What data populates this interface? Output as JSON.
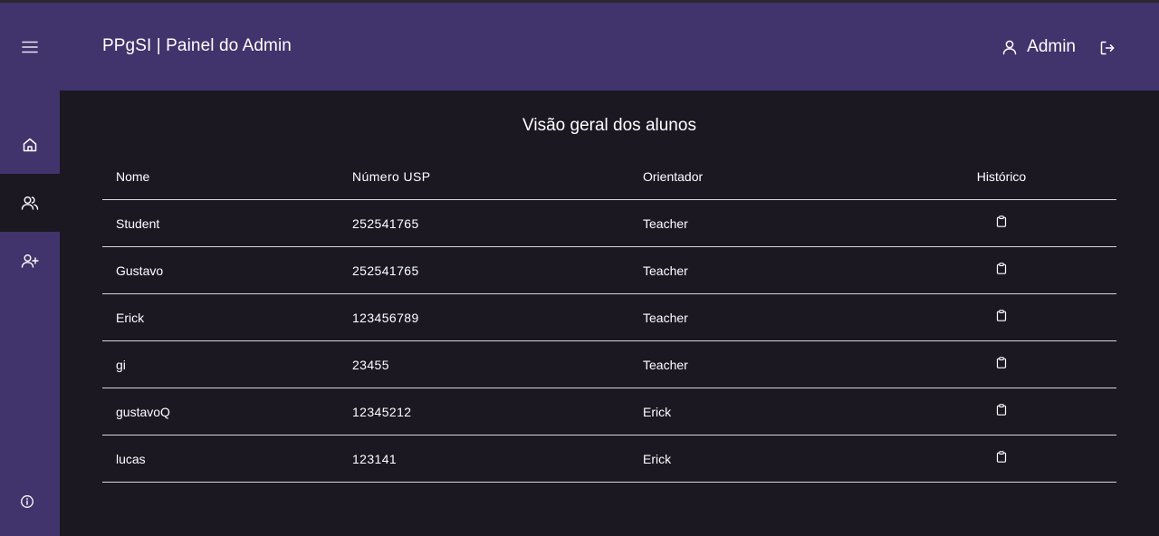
{
  "header": {
    "title": "PPgSI | Painel do Admin",
    "user_label": "Admin"
  },
  "icons": {
    "menu": "hamburger-icon",
    "user": "user-icon",
    "logout": "logout-icon",
    "home": "home-icon",
    "students": "users-icon",
    "add_user": "user-plus-icon",
    "info": "info-icon",
    "history": "clipboard-icon"
  },
  "sidebar": {
    "active_item": "students"
  },
  "main": {
    "title": "Visão geral dos alunos",
    "columns": [
      "Nome",
      "Número USP",
      "Orientador",
      "Histórico"
    ],
    "rows": [
      {
        "nome": "Student",
        "numero_usp": "252541765",
        "orientador": "Teacher"
      },
      {
        "nome": "Gustavo",
        "numero_usp": "252541765",
        "orientador": "Teacher"
      },
      {
        "nome": "Erick",
        "numero_usp": "123456789",
        "orientador": "Teacher"
      },
      {
        "nome": "gi",
        "numero_usp": "23455",
        "orientador": "Teacher"
      },
      {
        "nome": "gustavoQ",
        "numero_usp": "12345212",
        "orientador": "Erick"
      },
      {
        "nome": "lucas",
        "numero_usp": "123141",
        "orientador": "Erick"
      }
    ]
  },
  "colors": {
    "header_bg": "#41336b",
    "main_bg": "#1b1822",
    "text": "#ffffff"
  }
}
